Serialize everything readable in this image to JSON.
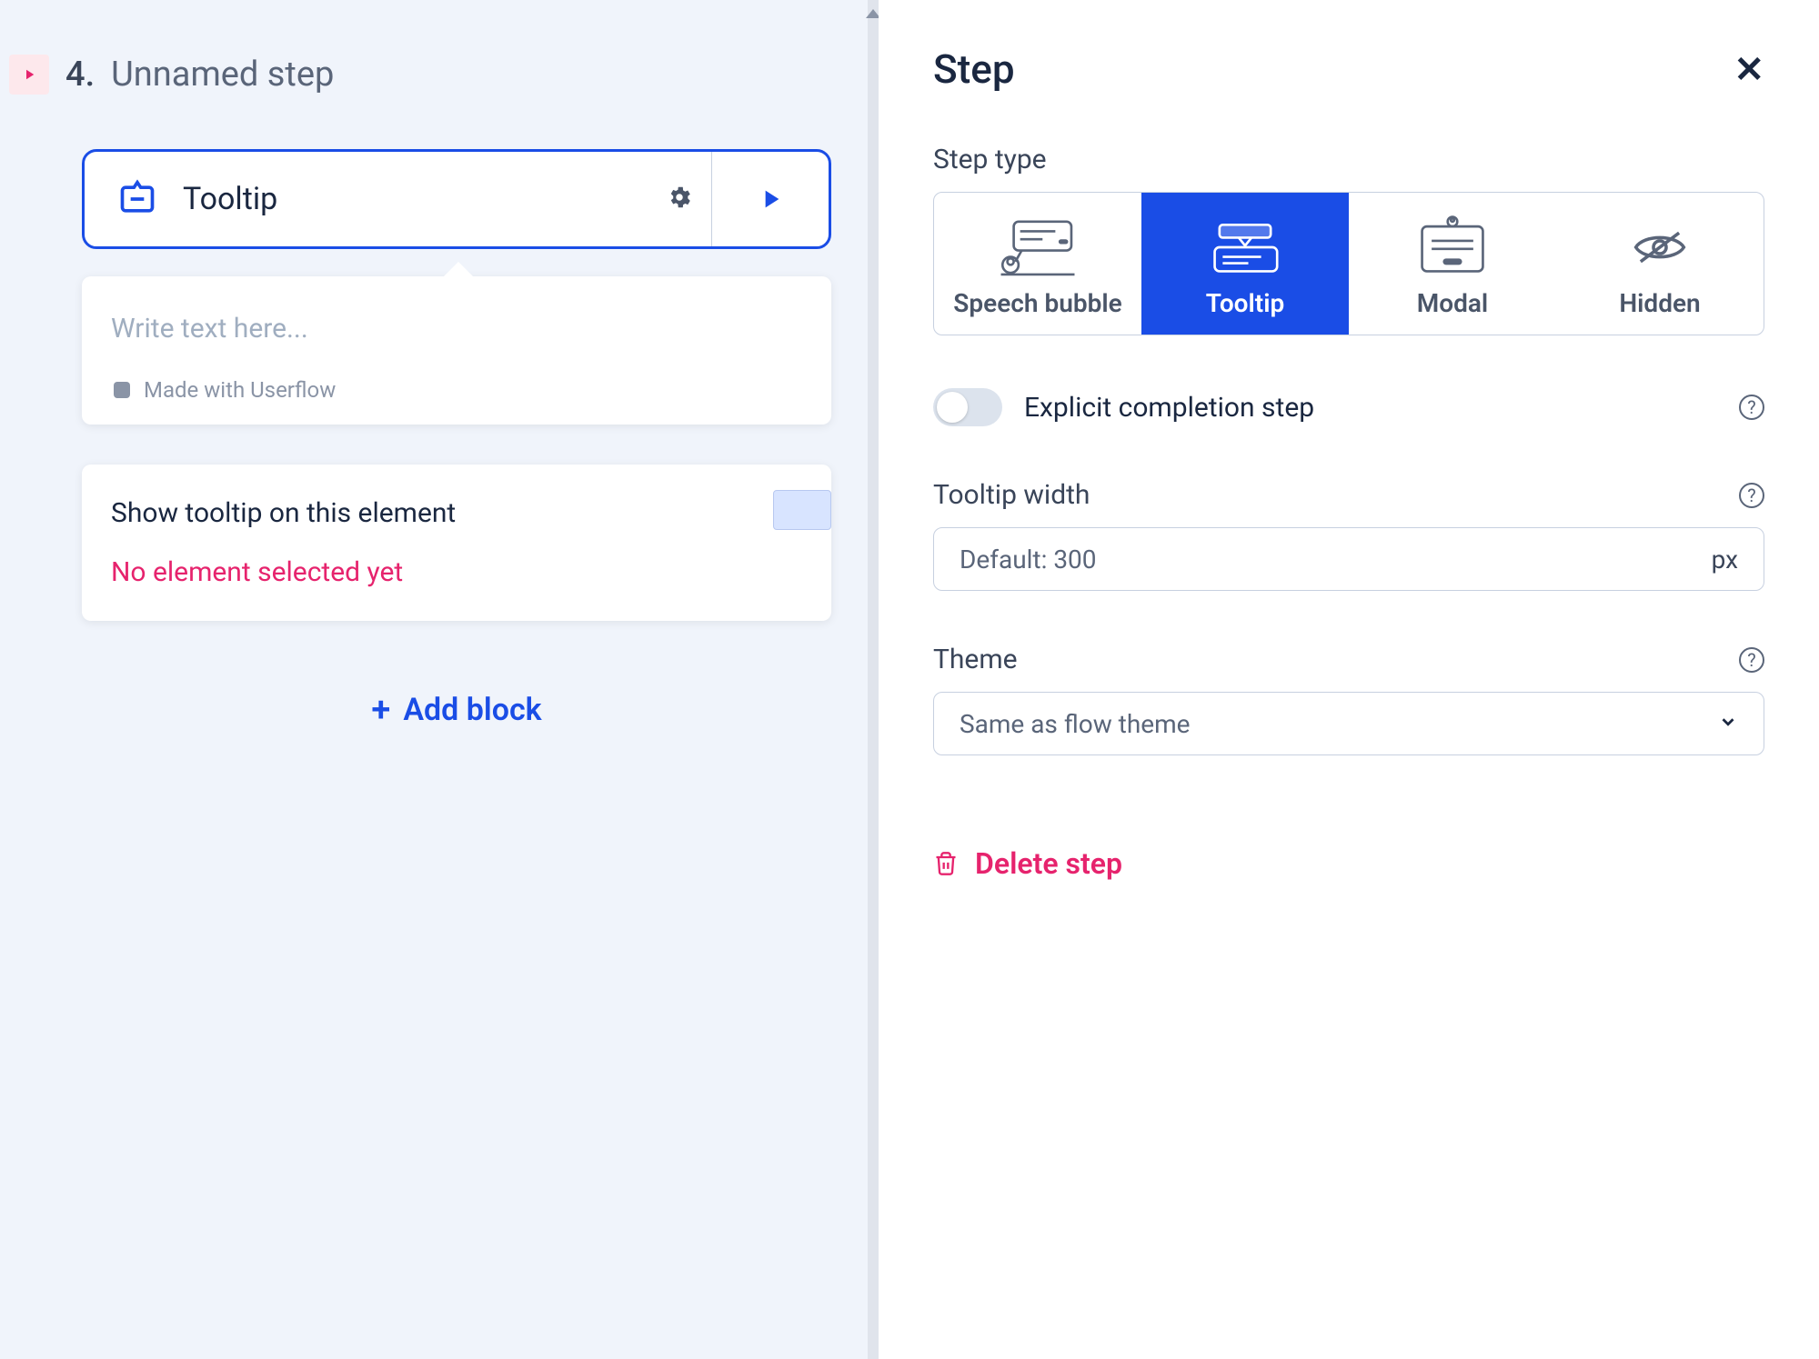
{
  "left": {
    "step_number": "4.",
    "step_title": "Unnamed step",
    "tooltip_label": "Tooltip",
    "preview_placeholder": "Write text here...",
    "made_with": "Made with Userflow",
    "element_label": "Show tooltip on this element",
    "element_warning": "No element selected yet",
    "add_block": "Add block"
  },
  "right": {
    "panel_title": "Step",
    "step_type_label": "Step type",
    "step_types": {
      "speech": "Speech bubble",
      "tooltip": "Tooltip",
      "modal": "Modal",
      "hidden": "Hidden"
    },
    "completion_label": "Explicit completion step",
    "width_label": "Tooltip width",
    "width_placeholder": "Default: 300",
    "width_unit": "px",
    "theme_label": "Theme",
    "theme_value": "Same as flow theme",
    "delete_label": "Delete step"
  }
}
